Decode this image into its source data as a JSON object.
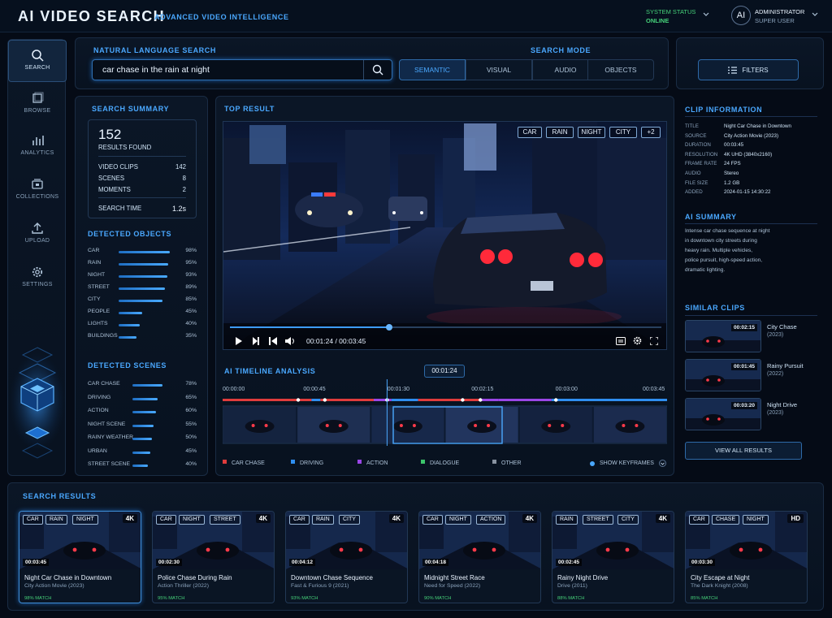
{
  "header": {
    "title": "AI VIDEO SEARCH",
    "subtitle": "ADVANCED VIDEO INTELLIGENCE",
    "status_label": "SYSTEM STATUS",
    "status_value": "ONLINE",
    "avatar": "AI",
    "user_name": "ADMINISTRATOR",
    "user_role": "SUPER USER"
  },
  "sidebar": {
    "items": [
      {
        "label": "SEARCH",
        "icon": "search-icon"
      },
      {
        "label": "BROWSE",
        "icon": "browse-icon"
      },
      {
        "label": "ANALYTICS",
        "icon": "analytics-icon"
      },
      {
        "label": "COLLECTIONS",
        "icon": "collections-icon"
      },
      {
        "label": "UPLOAD",
        "icon": "upload-icon"
      },
      {
        "label": "SETTINGS",
        "icon": "gear-icon"
      }
    ]
  },
  "search": {
    "title": "NATURAL LANGUAGE SEARCH",
    "query": "car chase in the rain at night",
    "mode_title": "SEARCH MODE",
    "modes": [
      "SEMANTIC",
      "VISUAL",
      "AUDIO",
      "OBJECTS"
    ],
    "filters": "FILTERS"
  },
  "summary": {
    "title": "SEARCH SUMMARY",
    "count": "152",
    "count_label": "RESULTS FOUND",
    "rows": [
      {
        "k": "VIDEO CLIPS",
        "v": "142"
      },
      {
        "k": "SCENES",
        "v": "8"
      },
      {
        "k": "MOMENTS",
        "v": "2"
      }
    ],
    "search_time_label": "SEARCH TIME",
    "search_time": "1.2s"
  },
  "objects": {
    "title": "DETECTED OBJECTS",
    "items": [
      {
        "label": "CAR",
        "value": "98%",
        "pct": 98
      },
      {
        "label": "RAIN",
        "value": "95%",
        "pct": 95
      },
      {
        "label": "NIGHT",
        "value": "93%",
        "pct": 93
      },
      {
        "label": "STREET",
        "value": "89%",
        "pct": 89
      },
      {
        "label": "CITY",
        "value": "85%",
        "pct": 85
      },
      {
        "label": "PEOPLE",
        "value": "45%",
        "pct": 45
      },
      {
        "label": "LIGHTS",
        "value": "40%",
        "pct": 40
      },
      {
        "label": "BUILDINGS",
        "value": "35%",
        "pct": 35
      }
    ]
  },
  "scenes": {
    "title": "DETECTED SCENES",
    "items": [
      {
        "label": "CAR CHASE",
        "value": "78%",
        "pct": 78
      },
      {
        "label": "DRIVING",
        "value": "65%",
        "pct": 65
      },
      {
        "label": "ACTION",
        "value": "60%",
        "pct": 60
      },
      {
        "label": "NIGHT SCENE",
        "value": "55%",
        "pct": 55
      },
      {
        "label": "RAINY WEATHER",
        "value": "50%",
        "pct": 50
      },
      {
        "label": "URBAN",
        "value": "45%",
        "pct": 45
      },
      {
        "label": "STREET SCENE",
        "value": "40%",
        "pct": 40
      }
    ]
  },
  "top": {
    "title": "TOP RESULT",
    "tags": [
      "CAR",
      "RAIN",
      "NIGHT",
      "CITY",
      "+2"
    ],
    "time": "00:01:24 / 00:03:45",
    "progress": 0.37
  },
  "timeline": {
    "title": "AI TIMELINE ANALYSIS",
    "current": "00:01:24",
    "marks": [
      "00:00:00",
      "00:00:45",
      "00:01:30",
      "00:02:15",
      "00:03:00",
      "00:03:45"
    ],
    "legend": [
      {
        "label": "CAR CHASE",
        "color": "#e03c3c"
      },
      {
        "label": "DRIVING",
        "color": "#2f8ef0"
      },
      {
        "label": "ACTION",
        "color": "#9a46e6"
      },
      {
        "label": "DIALOGUE",
        "color": "#3cc46a"
      },
      {
        "label": "OTHER",
        "color": "#8892a0"
      }
    ],
    "keyframes": "SHOW KEYFRAMES"
  },
  "clip": {
    "title": "CLIP INFORMATION",
    "fields": [
      {
        "k": "TITLE",
        "v": "Night Car Chase in Downtown"
      },
      {
        "k": "SOURCE",
        "v": "City Action Movie (2023)"
      },
      {
        "k": "DURATION",
        "v": "00:03:45"
      },
      {
        "k": "RESOLUTION",
        "v": "4K UHD (3840x2160)"
      },
      {
        "k": "FRAME RATE",
        "v": "24 FPS"
      },
      {
        "k": "AUDIO",
        "v": "Stereo"
      },
      {
        "k": "FILE SIZE",
        "v": "1.2 GB"
      },
      {
        "k": "ADDED",
        "v": "2024-01-15 14:30:22"
      }
    ],
    "ai_title": "AI SUMMARY",
    "ai_summary": [
      "Intense car chase sequence at night",
      "in downtown city streets during",
      "heavy rain. Multiple vehicles,",
      "police pursuit, high-speed action,",
      "dramatic lighting."
    ],
    "similar_title": "SIMILAR CLIPS",
    "similar": [
      {
        "dur": "00:02:15",
        "title": "City Chase",
        "year": "(2023)"
      },
      {
        "dur": "00:01:45",
        "title": "Rainy Pursuit",
        "year": "(2022)"
      },
      {
        "dur": "00:03:20",
        "title": "Night Drive",
        "year": "(2023)"
      }
    ],
    "view_all": "VIEW ALL RESULTS"
  },
  "results": {
    "title": "SEARCH RESULTS",
    "cards": [
      {
        "tags": [
          "CAR",
          "RAIN",
          "NIGHT"
        ],
        "q": "4K",
        "dur": "00:03:45",
        "title": "Night Car Chase in Downtown",
        "sub": "City Action Movie (2023)",
        "match": "98% MATCH"
      },
      {
        "tags": [
          "CAR",
          "NIGHT",
          "STREET"
        ],
        "q": "4K",
        "dur": "00:02:30",
        "title": "Police Chase During Rain",
        "sub": "Action Thriller (2022)",
        "match": "95% MATCH"
      },
      {
        "tags": [
          "CAR",
          "RAIN",
          "CITY"
        ],
        "q": "4K",
        "dur": "00:04:12",
        "title": "Downtown Chase Sequence",
        "sub": "Fast & Furious 9 (2021)",
        "match": "93% MATCH"
      },
      {
        "tags": [
          "CAR",
          "NIGHT",
          "ACTION"
        ],
        "q": "4K",
        "dur": "00:04:18",
        "title": "Midnight Street Race",
        "sub": "Need for Speed (2022)",
        "match": "90% MATCH"
      },
      {
        "tags": [
          "RAIN",
          "STREET",
          "CITY"
        ],
        "q": "4K",
        "dur": "00:02:45",
        "title": "Rainy Night Drive",
        "sub": "Drive (2011)",
        "match": "88% MATCH"
      },
      {
        "tags": [
          "CAR",
          "CHASE",
          "NIGHT"
        ],
        "q": "HD",
        "dur": "00:03:30",
        "title": "City Escape at Night",
        "sub": "The Dark Knight (2008)",
        "match": "85% MATCH"
      }
    ]
  }
}
